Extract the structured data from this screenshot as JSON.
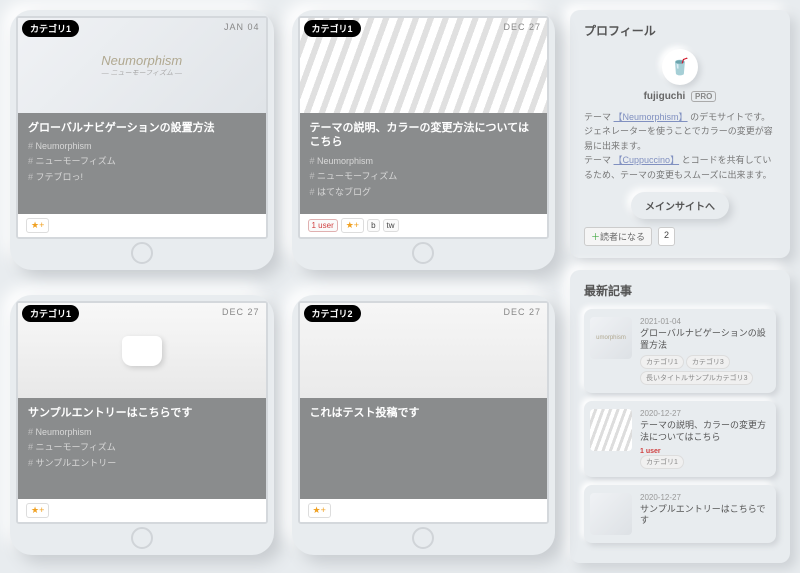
{
  "cards": [
    {
      "category": "カテゴリ1",
      "date": "JAN 04",
      "img_label": "Neumorphism",
      "img_sub": "— ニューモーフィズム —",
      "img_class": "",
      "title": "グローバルナビゲーションの設置方法",
      "tags": [
        "Neumorphism",
        "ニューモーフィズム",
        "フテブロっ!"
      ],
      "badges": [
        "star"
      ]
    },
    {
      "category": "カテゴリ1",
      "date": "DEC 27",
      "img_class": "stripes",
      "title": "テーマの説明、カラーの変更方法についてはこちら",
      "tags": [
        "Neumorphism",
        "ニューモーフィズム",
        "はてなブログ"
      ],
      "badges": [
        "1user",
        "star",
        "b",
        "tw"
      ]
    },
    {
      "category": "カテゴリ1",
      "date": "DEC 27",
      "img_class": "cup",
      "title": "サンプルエントリーはこちらです",
      "tags": [
        "Neumorphism",
        "ニューモーフィズム",
        "サンプルエントリー"
      ],
      "badges": [
        "star"
      ]
    },
    {
      "category": "カテゴリ2",
      "date": "DEC 27",
      "img_class": "desk",
      "title": "これはテスト投稿です",
      "tags": [],
      "badges": [
        "star"
      ]
    }
  ],
  "profile": {
    "heading": "プロフィール",
    "avatar_emoji": "🥤",
    "username": "fujiguchi",
    "pro_label": "PRO",
    "line1_pre": "テーマ",
    "link1": "【Neumorphism】",
    "line1_post": "のデモサイトです。",
    "line2": "ジェネレーターを使うことでカラーの変更が容易に出来ます。",
    "line3_pre": "テーマ",
    "link2": "【Cuppuccino】",
    "line3_post": "とコードを共有しているため、テーマの変更もスムーズに出来ます。",
    "button": "メインサイトへ",
    "subscribe": "読者になる",
    "subscribe_count": "2"
  },
  "recent": {
    "heading": "最新記事",
    "items": [
      {
        "date": "2021-01-04",
        "title": "グローバルナビゲーションの設置方法",
        "thumb_label": "umorphism",
        "thumb_class": "",
        "chips": [
          "カテゴリ1",
          "カテゴリ3"
        ],
        "chips2": [
          "長いタイトルサンプルカテゴリ3"
        ]
      },
      {
        "date": "2020-12-27",
        "title": "テーマの説明、カラーの変更方法についてはこちら",
        "thumb_class": "stripes",
        "users": "1 user",
        "chips": [
          "カテゴリ1"
        ]
      },
      {
        "date": "2020-12-27",
        "title": "サンプルエントリーはこちらです",
        "thumb_class": "cup",
        "chips": []
      }
    ]
  }
}
